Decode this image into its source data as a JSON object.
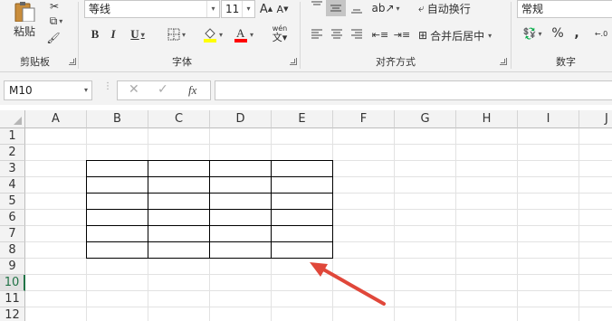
{
  "ribbon": {
    "clipboard": {
      "paste_label": "粘贴",
      "group_label": "剪贴板"
    },
    "font": {
      "font_name": "等线",
      "font_size": "11",
      "bold": "B",
      "italic": "I",
      "underline": "U",
      "increase": "A",
      "decrease": "A",
      "group_label": "字体",
      "phonetic": "wén"
    },
    "alignment": {
      "wrap_text": "自动换行",
      "merge_center": "合并后居中",
      "group_label": "对齐方式"
    },
    "number": {
      "format": "常规",
      "percent": "%",
      "comma": ",",
      "group_label": "数字"
    }
  },
  "formula_bar": {
    "name_box": "M10",
    "fx_label": "fx",
    "formula": ""
  },
  "grid": {
    "columns": [
      "A",
      "B",
      "C",
      "D",
      "E",
      "F",
      "G",
      "H",
      "I",
      "J"
    ],
    "rows": [
      "1",
      "2",
      "3",
      "4",
      "5",
      "6",
      "7",
      "8",
      "9",
      "10",
      "11",
      "12"
    ],
    "selected_row": "10"
  },
  "colors": {
    "accent": "#217346",
    "arrow": "#e0473a",
    "highlight": "#ffff00",
    "font_color": "#ff0000"
  }
}
